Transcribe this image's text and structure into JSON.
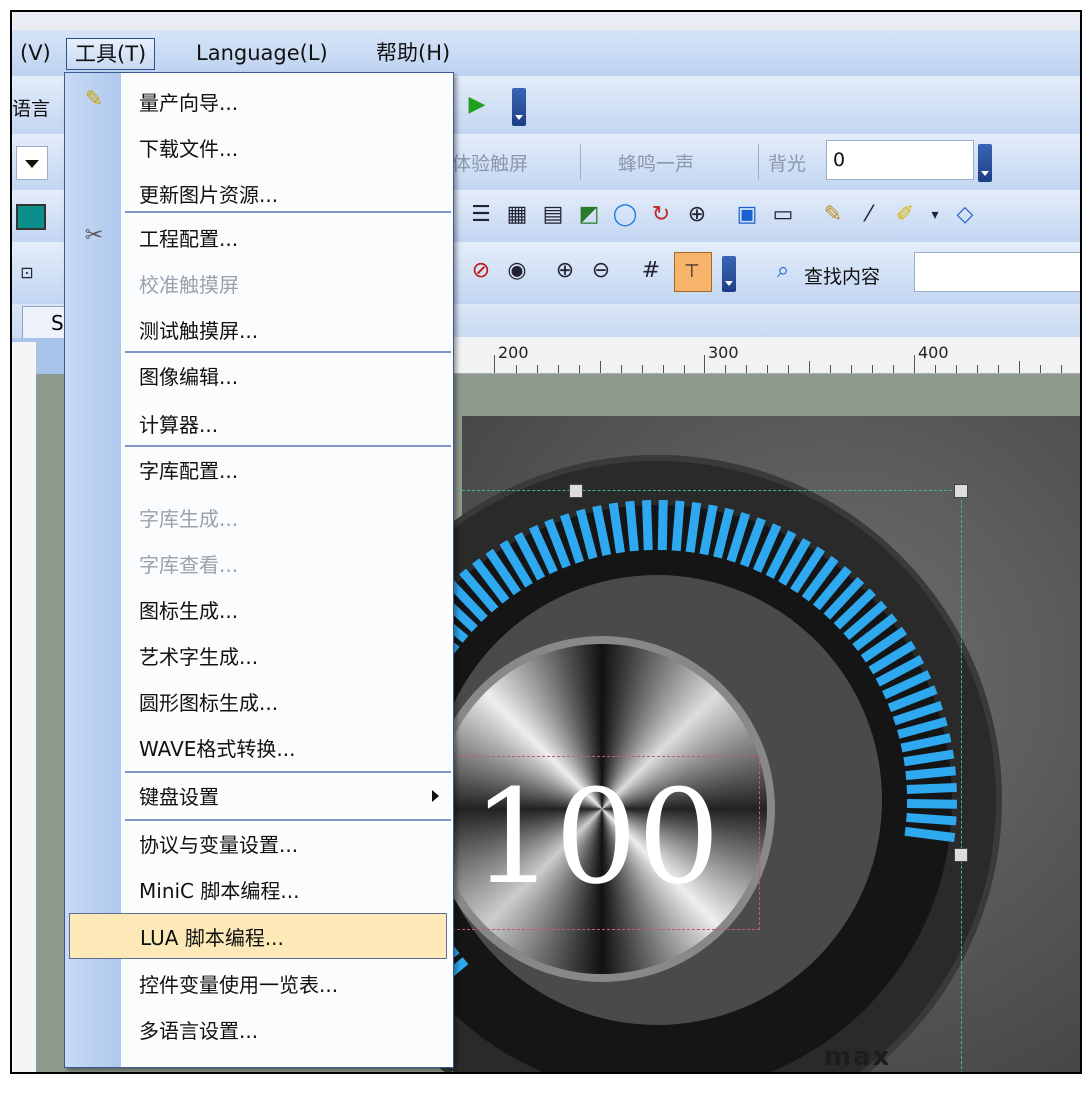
{
  "menubar": {
    "items": [
      "(V)",
      "工具(T)",
      "Language(L)",
      "帮助(H)"
    ]
  },
  "toolbar1": {
    "lang_label": "语言"
  },
  "toolbar2": {
    "touch_label": "体验触屏",
    "beep_label": "蜂鸣一声",
    "backlight_label": "背光",
    "backlight_value": "0"
  },
  "toolbar4": {
    "search_label": "查找内容"
  },
  "tab": {
    "label": "S"
  },
  "ruler": {
    "labels": [
      "200",
      "300",
      "400"
    ]
  },
  "canvas": {
    "value_text": "100",
    "max_label": "max"
  },
  "dropdown": {
    "items": [
      {
        "label": "量产向导...",
        "disabled": false,
        "icon": "wand-icon"
      },
      {
        "label": "下载文件...",
        "disabled": false
      },
      {
        "label": "更新图片资源...",
        "disabled": false
      },
      {
        "label": "工程配置...",
        "disabled": false,
        "icon": "tools-icon"
      },
      {
        "label": "校准触摸屏",
        "disabled": true
      },
      {
        "label": "测试触摸屏...",
        "disabled": false
      },
      {
        "label": "图像编辑...",
        "disabled": false
      },
      {
        "label": "计算器...",
        "disabled": false
      },
      {
        "label": "字库配置...",
        "disabled": false
      },
      {
        "label": "字库生成...",
        "disabled": true
      },
      {
        "label": "字库查看...",
        "disabled": true
      },
      {
        "label": "图标生成...",
        "disabled": false
      },
      {
        "label": "艺术字生成...",
        "disabled": false
      },
      {
        "label": "圆形图标生成...",
        "disabled": false
      },
      {
        "label": "WAVE格式转换...",
        "disabled": false
      },
      {
        "label": "键盘设置",
        "disabled": false,
        "submenu": true
      },
      {
        "label": "协议与变量设置...",
        "disabled": false
      },
      {
        "label": "MiniC 脚本编程...",
        "disabled": false
      },
      {
        "label": "LUA 脚本编程...",
        "disabled": false,
        "highlighted": true
      },
      {
        "label": "控件变量使用一览表...",
        "disabled": false
      },
      {
        "label": "多语言设置...",
        "disabled": false
      }
    ]
  }
}
